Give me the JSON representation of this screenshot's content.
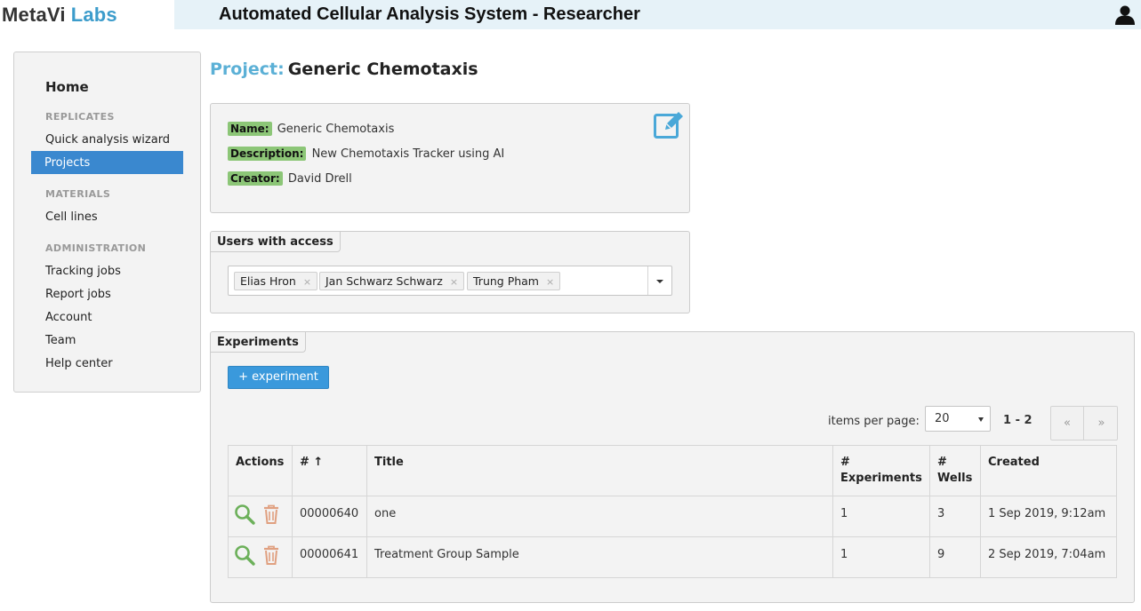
{
  "logo": {
    "part1": "MetaVi",
    "part2": "Labs"
  },
  "app_title": "Automated Cellular Analysis System - Researcher",
  "sidebar": {
    "home": "Home",
    "sections": {
      "replicates": "REPLICATES",
      "materials": "MATERIALS",
      "administration": "ADMINISTRATION"
    },
    "items": {
      "quick_analysis": "Quick analysis wizard",
      "projects": "Projects",
      "cell_lines": "Cell lines",
      "tracking_jobs": "Tracking jobs",
      "report_jobs": "Report jobs",
      "account": "Account",
      "team": "Team",
      "help_center": "Help center"
    }
  },
  "project": {
    "heading_prefix": "Project:",
    "heading_name": "Generic Chemotaxis",
    "name_label": "Name:",
    "name": "Generic Chemotaxis",
    "description_label": "Description:",
    "description": "New Chemotaxis Tracker using AI",
    "creator_label": "Creator:",
    "creator": "David Drell"
  },
  "users_access": {
    "legend": "Users with access",
    "users": [
      "Elias Hron",
      "Jan Schwarz Schwarz",
      "Trung Pham"
    ],
    "remove_glyph": "×"
  },
  "experiments": {
    "legend": "Experiments",
    "add_button": "+ experiment",
    "items_per_page_label": "items per page:",
    "items_per_page": "20",
    "range": "1 - 2",
    "prev": "«",
    "next": "»",
    "columns": {
      "actions": "Actions",
      "id": "# ↑",
      "title": "Title",
      "experiments_1": "#",
      "experiments_2": "Experiments",
      "wells_1": "#",
      "wells_2": "Wells",
      "created": "Created"
    },
    "rows": [
      {
        "id": "00000640",
        "title": "one",
        "experiments": "1",
        "wells": "3",
        "created": "1 Sep 2019, 9:12am"
      },
      {
        "id": "00000641",
        "title": "Treatment Group Sample",
        "experiments": "1",
        "wells": "9",
        "created": "2 Sep 2019, 7:04am"
      }
    ]
  },
  "colors": {
    "accent_blue": "#3a88cf",
    "heading_blue": "#5bb0d6",
    "tag_green": "#8cc677",
    "view_green": "#6cb05a",
    "delete_orange": "#e0a080"
  },
  "icons": {
    "user": "user-icon",
    "edit": "edit-icon",
    "view": "magnifier-icon",
    "delete": "trash-icon"
  }
}
